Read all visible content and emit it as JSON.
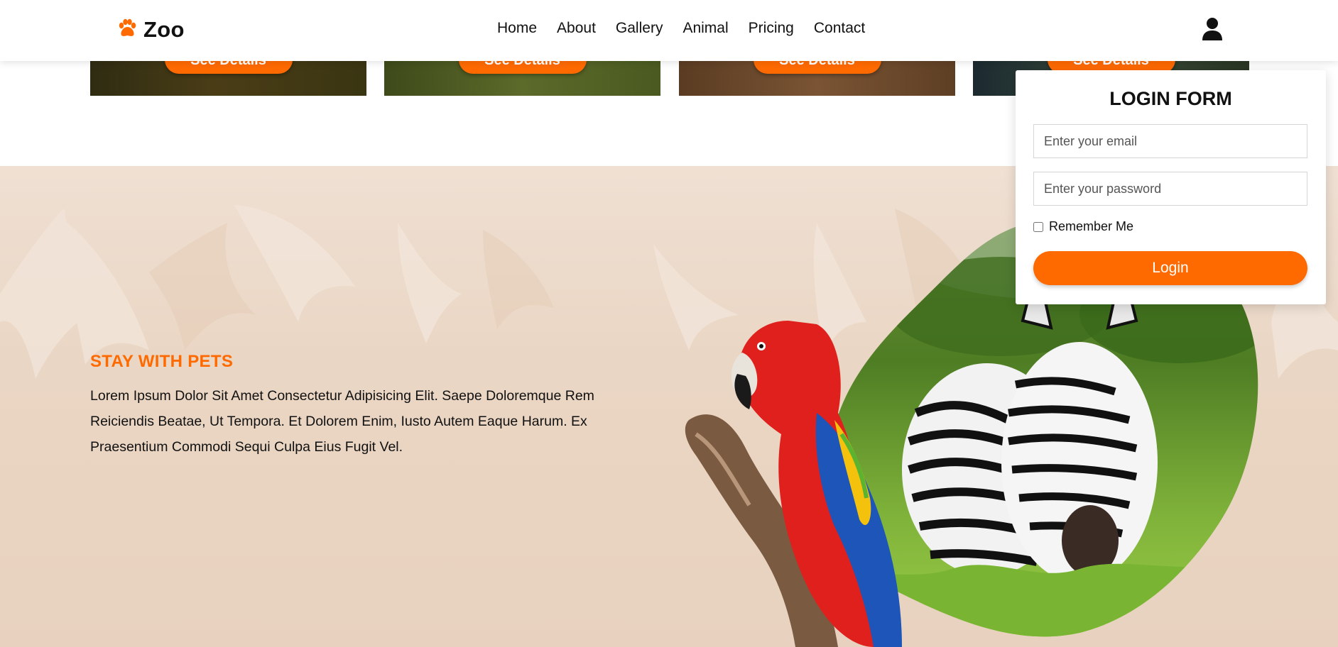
{
  "header": {
    "logo_text": "Zoo",
    "logo_icon": "paw-icon",
    "nav": [
      "Home",
      "About",
      "Gallery",
      "Animal",
      "Pricing",
      "Contact"
    ],
    "user_icon": "user-icon"
  },
  "cards": {
    "button_label": "See Details"
  },
  "login_form": {
    "title": "LOGIN FORM",
    "email_placeholder": "Enter your email",
    "password_placeholder": "Enter your password",
    "remember_label": "Remember Me",
    "login_label": "Login"
  },
  "stay": {
    "title": "STAY WITH PETS",
    "text": "Lorem Ipsum Dolor Sit Amet Consectetur Adipisicing Elit. Saepe Doloremque Rem Reiciendis Beatae, Ut Tempora. Et Dolorem Enim, Iusto Autem Eaque Harum. Ex Praesentium Commodi Sequi Culpa Eius Fugit Vel."
  },
  "colors": {
    "accent": "#ff6a00",
    "section_bg": "#ead6c4"
  }
}
